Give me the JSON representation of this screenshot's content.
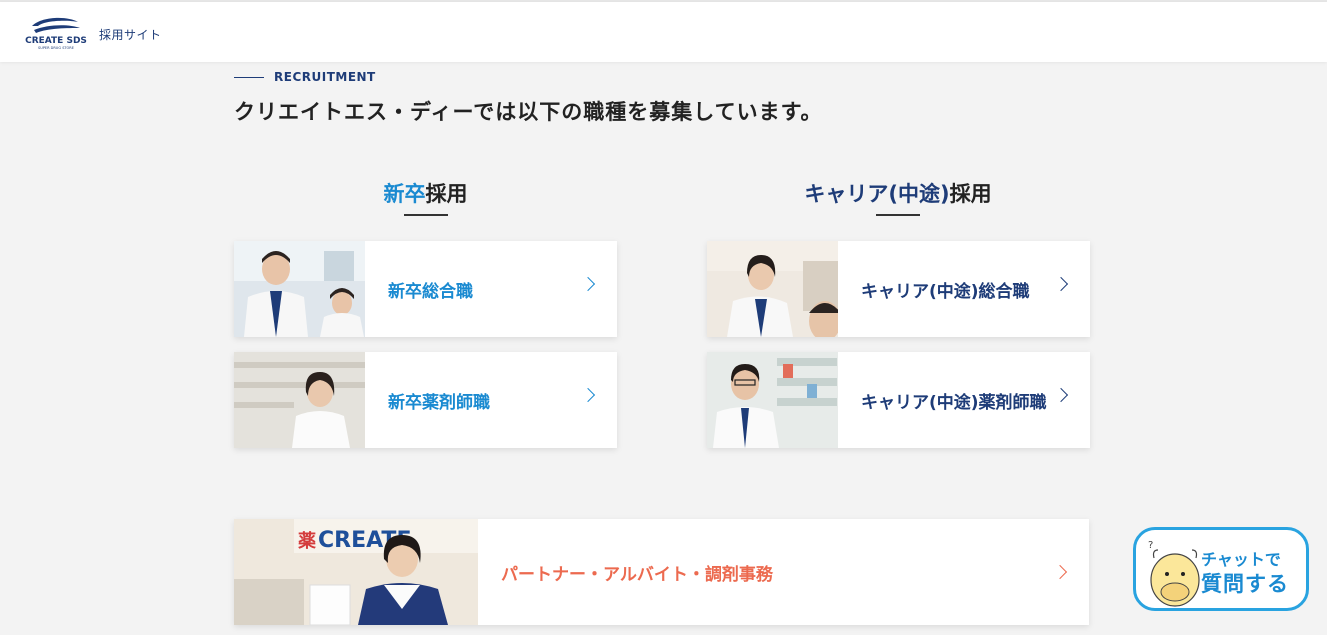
{
  "header": {
    "logo_text": "CREATE SDS",
    "logo_subtext": "SUPER DRUG STORE",
    "site_name": "採用サイト"
  },
  "section": {
    "eyebrow": "RECRUITMENT",
    "lead": "クリエイトエス・ディーでは以下の職種を募集しています。"
  },
  "new_grad": {
    "title_accent": "新卒",
    "title_rest": "採用",
    "cards": [
      {
        "label": "新卒総合職"
      },
      {
        "label": "新卒薬剤師職"
      }
    ]
  },
  "career": {
    "title_accent": "キャリア(中途)",
    "title_rest": "採用",
    "cards": [
      {
        "label": "キャリア(中途)総合職"
      },
      {
        "label": "キャリア(中途)薬剤師職"
      }
    ]
  },
  "partner": {
    "label": "パートナー・アルバイト・調剤事務",
    "photo_sign": "CREATE",
    "photo_kanji": "薬"
  },
  "chat": {
    "line1": "チャットで",
    "line2": "質問する"
  },
  "colors": {
    "navy": "#1e3c78",
    "blue": "#1a8ad1",
    "orange": "#ec6a4f",
    "chat_border": "#29a3e0"
  },
  "icons": [
    "logo",
    "chevron-right-icon",
    "mascot-icon"
  ]
}
